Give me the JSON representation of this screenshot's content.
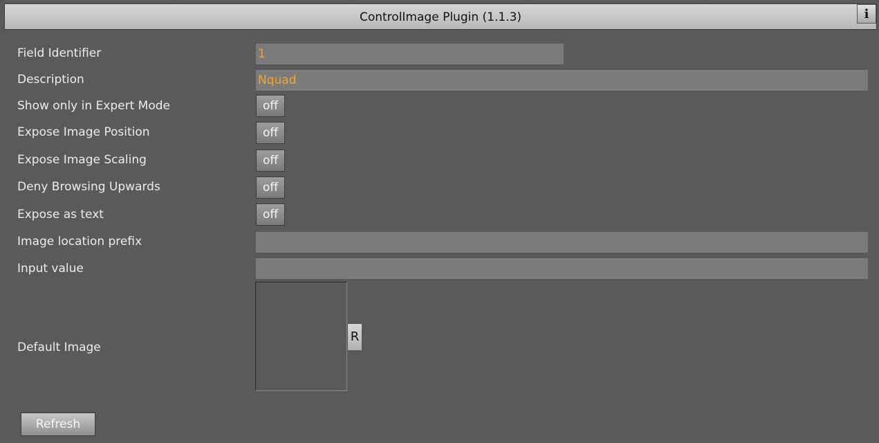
{
  "window": {
    "title": "ControlImage Plugin (1.1.3)",
    "info_label": "i"
  },
  "fields": {
    "field_identifier": {
      "label": "Field Identifier",
      "value": "1"
    },
    "description": {
      "label": "Description",
      "value": "Nquad"
    },
    "show_expert": {
      "label": "Show only in Expert Mode",
      "value": "off"
    },
    "expose_position": {
      "label": "Expose Image Position",
      "value": "off"
    },
    "expose_scaling": {
      "label": "Expose Image Scaling",
      "value": "off"
    },
    "deny_browsing": {
      "label": "Deny Browsing Upwards",
      "value": "off"
    },
    "expose_text": {
      "label": "Expose as text",
      "value": "off"
    },
    "location_prefix": {
      "label": "Image location prefix",
      "value": ""
    },
    "input_value": {
      "label": "Input value",
      "value": ""
    },
    "default_image": {
      "label": "Default Image",
      "reset_label": "R"
    }
  },
  "actions": {
    "refresh_label": "Refresh"
  }
}
